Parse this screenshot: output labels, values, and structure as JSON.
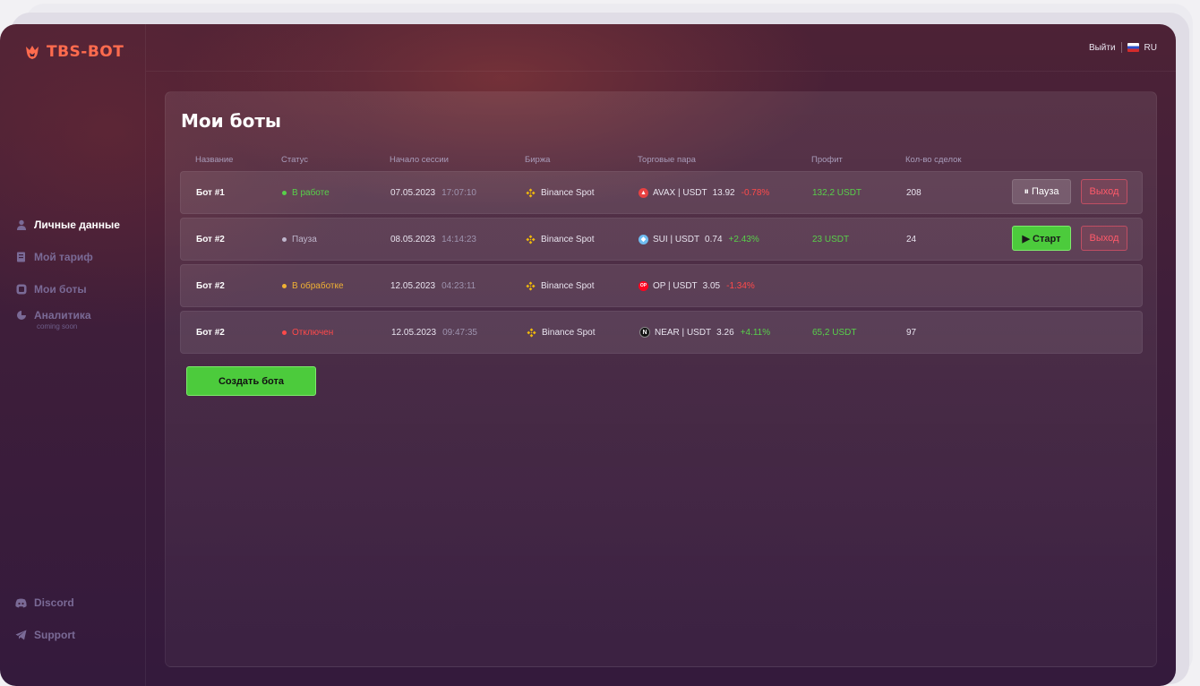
{
  "app": {
    "logo_text": "TBS-BOT"
  },
  "topbar": {
    "logout_label": "Выйти",
    "language": "RU"
  },
  "sidebar": {
    "items": [
      {
        "label": "Личные данные",
        "icon": "user-icon",
        "active": true
      },
      {
        "label": "Мой тариф",
        "icon": "tariff-icon",
        "active": false
      },
      {
        "label": "Мои боты",
        "icon": "bot-icon",
        "active": false
      },
      {
        "label": "Аналитика",
        "sub": "coming soon",
        "icon": "analytics-icon",
        "active": false
      }
    ],
    "footer": [
      {
        "label": "Discord",
        "icon": "discord-icon"
      },
      {
        "label": "Support",
        "icon": "telegram-icon"
      }
    ]
  },
  "main": {
    "title": "Мои боты",
    "columns": [
      "Название",
      "Статус",
      "Начало сессии",
      "Биржа",
      "Торговые пара",
      "Профит",
      "Кол-во сделок"
    ],
    "rows": [
      {
        "name": "Бот #1",
        "status": "В работе",
        "status_type": "running",
        "date": "07.05.2023",
        "time": "17:07:10",
        "exchange": "Binance Spot",
        "coin_icon": "avax-icon",
        "pair": "AVAX | USDT",
        "price": "13.92",
        "change": "-0.78%",
        "profit": "132,2 USDT",
        "trades": "208",
        "action_label": "⏸ Пауза",
        "exit_label": "Выход"
      },
      {
        "name": "Бот #2",
        "status": "Пауза",
        "status_type": "paused",
        "date": "08.05.2023",
        "time": "14:14:23",
        "exchange": "Binance Spot",
        "coin_icon": "sui-icon",
        "pair": "SUI | USDT",
        "price": "0.74",
        "change": "+2.43%",
        "profit": "23 USDT",
        "trades": "24",
        "action_label": "▶ Старт",
        "exit_label": "Выход"
      },
      {
        "name": "Бот #2",
        "status": "В обработке",
        "status_type": "processing",
        "date": "12.05.2023",
        "time": "04:23:11",
        "exchange": "Binance Spot",
        "coin_icon": "op-icon",
        "pair": "OP | USDT",
        "price": "3.05",
        "change": "-1.34%",
        "profit": "",
        "trades": ""
      },
      {
        "name": "Бот #2",
        "status": "Отключен",
        "status_type": "disabled",
        "date": "12.05.2023",
        "time": "09:47:35",
        "exchange": "Binance Spot",
        "coin_icon": "near-icon",
        "pair": "NEAR | USDT",
        "price": "3.26",
        "change": "+4.11%",
        "profit": "65,2 USDT",
        "trades": "97"
      }
    ],
    "create_button": "Создать бота"
  },
  "colors": {
    "accent_green": "#4ccb3c",
    "danger": "#ff4a4a",
    "processing": "#f0b234",
    "logo": "#ff6b4e"
  }
}
